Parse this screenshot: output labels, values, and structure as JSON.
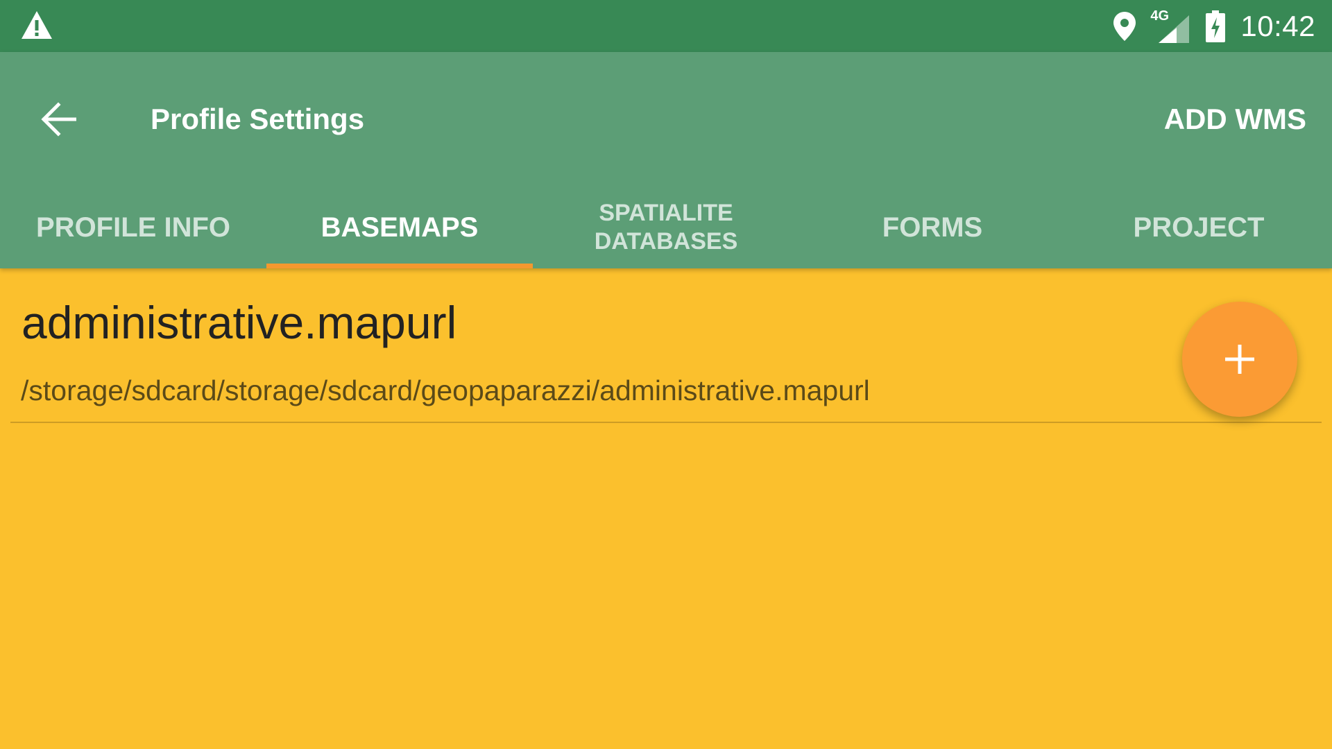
{
  "status_bar": {
    "time": "10:42",
    "network_type": "4G",
    "icons": [
      "warning-icon",
      "location-icon",
      "signal-icon",
      "battery-charging-icon"
    ]
  },
  "app_bar": {
    "title": "Profile Settings",
    "action_label": "ADD WMS",
    "back_icon": "arrow-left-icon"
  },
  "tabs": [
    {
      "label": "PROFILE INFO",
      "active": false
    },
    {
      "label": "BASEMAPS",
      "active": true
    },
    {
      "label": "SPATIALITE DATABASES",
      "active": false
    },
    {
      "label": "FORMS",
      "active": false
    },
    {
      "label": "PROJECT",
      "active": false
    }
  ],
  "basemaps": [
    {
      "title": "administrative.mapurl",
      "path": "/storage/sdcard/storage/sdcard/geopaparazzi/administrative.mapurl"
    }
  ],
  "fab": {
    "icon": "plus-icon"
  },
  "colors": {
    "status_bar": "#388955",
    "app_bar": "#5C9E76",
    "background": "#FBC02D",
    "tab_indicator": "#F4982F",
    "fab": "#FB9B34"
  }
}
